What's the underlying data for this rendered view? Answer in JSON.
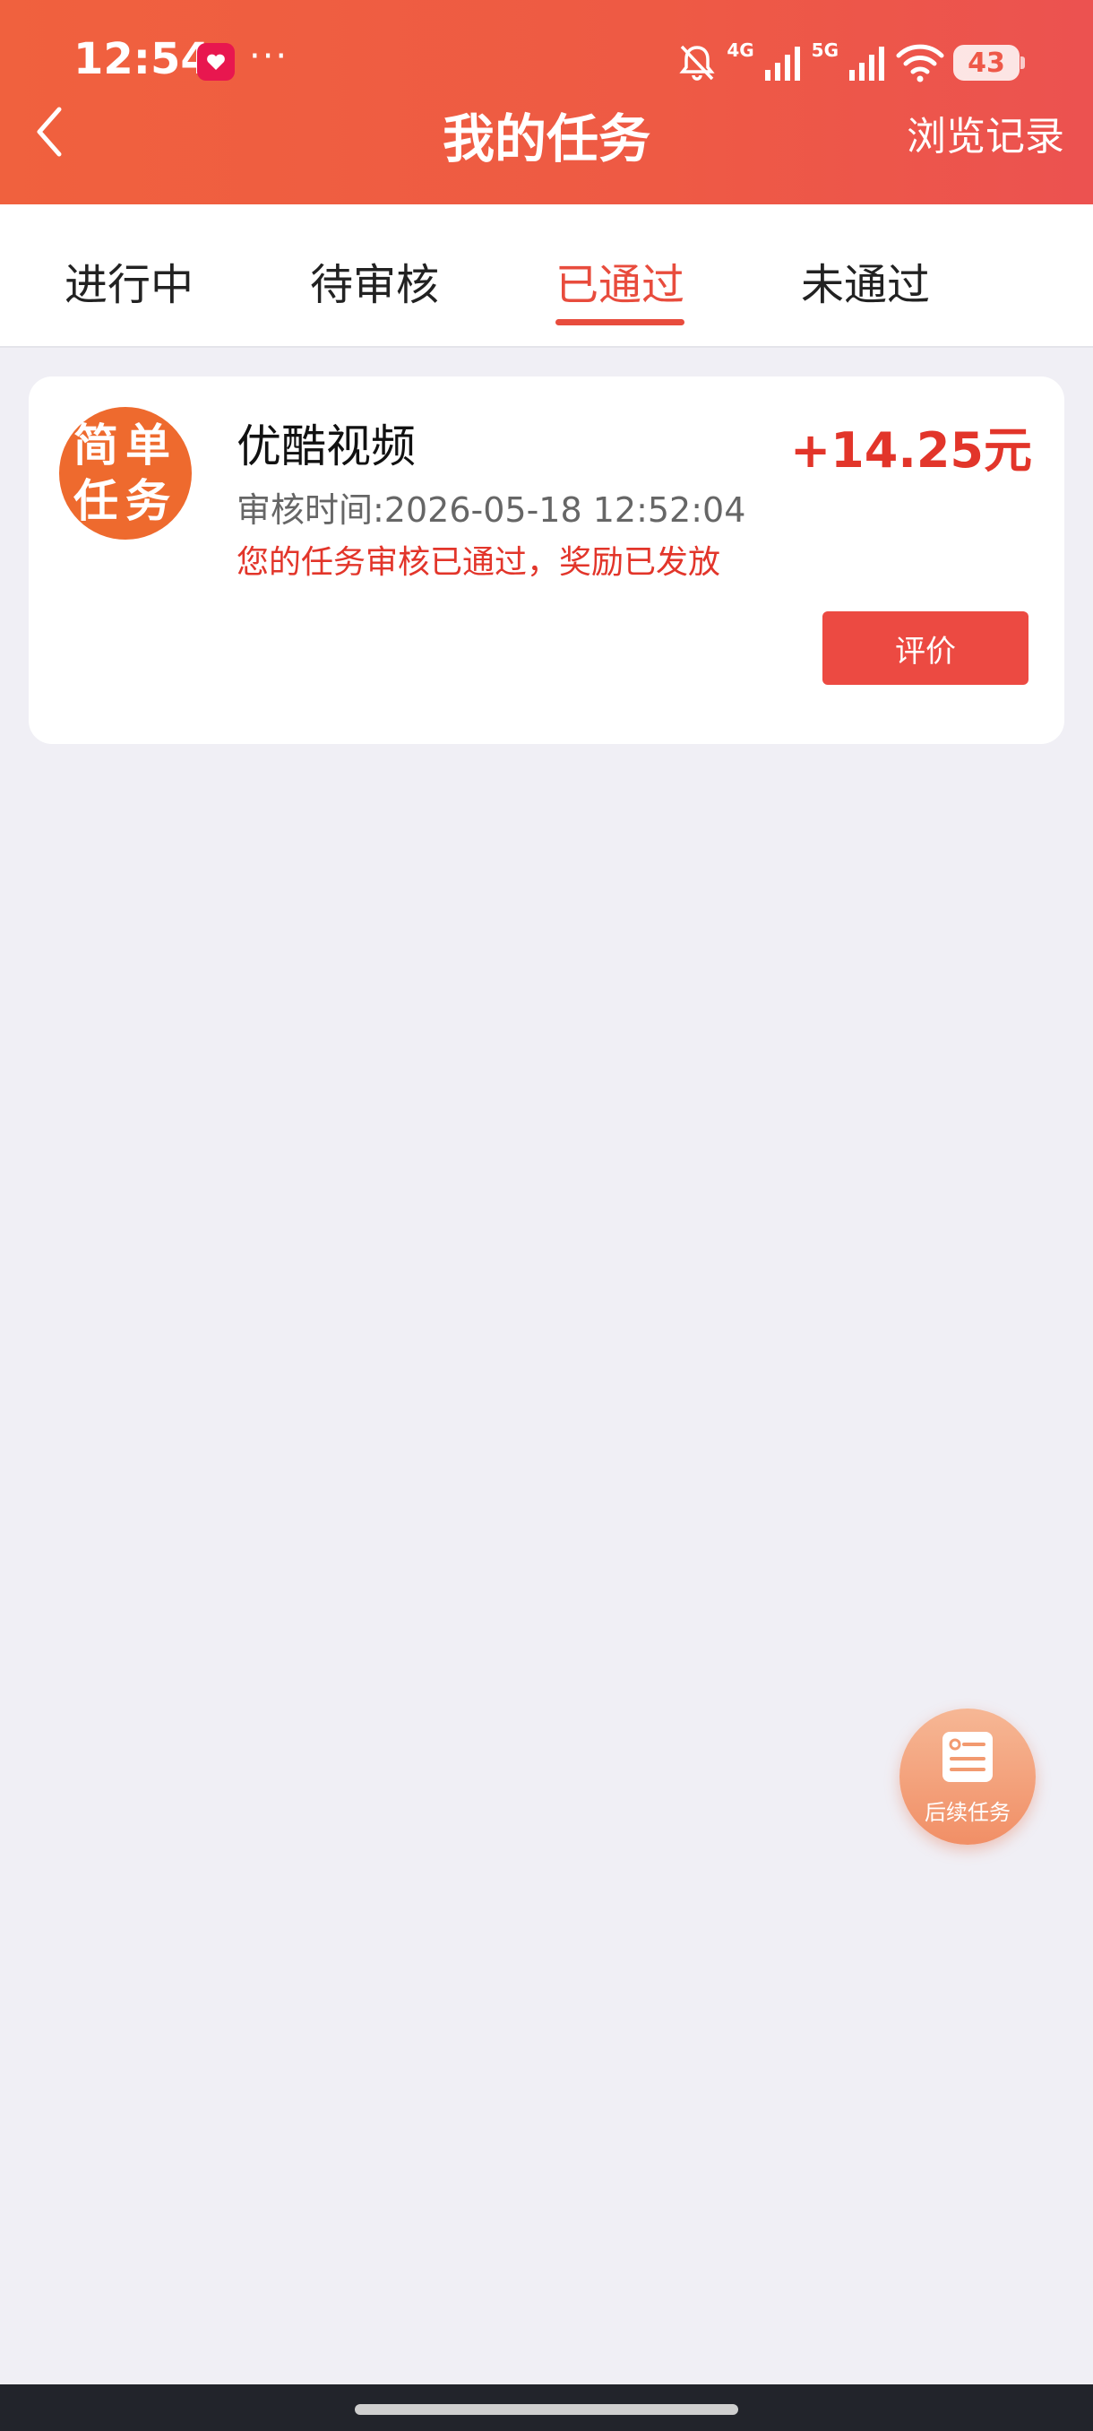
{
  "status_bar": {
    "time": "12:54",
    "dots": "···",
    "net_4g": "4G",
    "net_5g": "5G",
    "battery": "43"
  },
  "nav": {
    "title": "我的任务",
    "right_link": "浏览记录"
  },
  "tabs": [
    {
      "label": "进行中",
      "active": false
    },
    {
      "label": "待审核",
      "active": false
    },
    {
      "label": "已通过",
      "active": true
    },
    {
      "label": "未通过",
      "active": false
    }
  ],
  "task": {
    "badge_line1": "简单",
    "badge_line2": "任务",
    "name": "优酷视频",
    "reward": "+14.25元",
    "review_time": "审核时间:2026-05-18 12:52:04",
    "status_message": "您的任务审核已通过，奖励已发放",
    "review_button": "评价"
  },
  "float_button": {
    "label": "后续任务"
  },
  "colors": {
    "header_gradient_start": "#f0613e",
    "header_gradient_end": "#ec5250",
    "accent_red": "#e2352a",
    "badge_orange": "#ee6a2e"
  },
  "icons": [
    "back-icon",
    "notification-off-icon",
    "signal-icon",
    "wifi-icon",
    "battery-icon",
    "task-list-icon"
  ]
}
